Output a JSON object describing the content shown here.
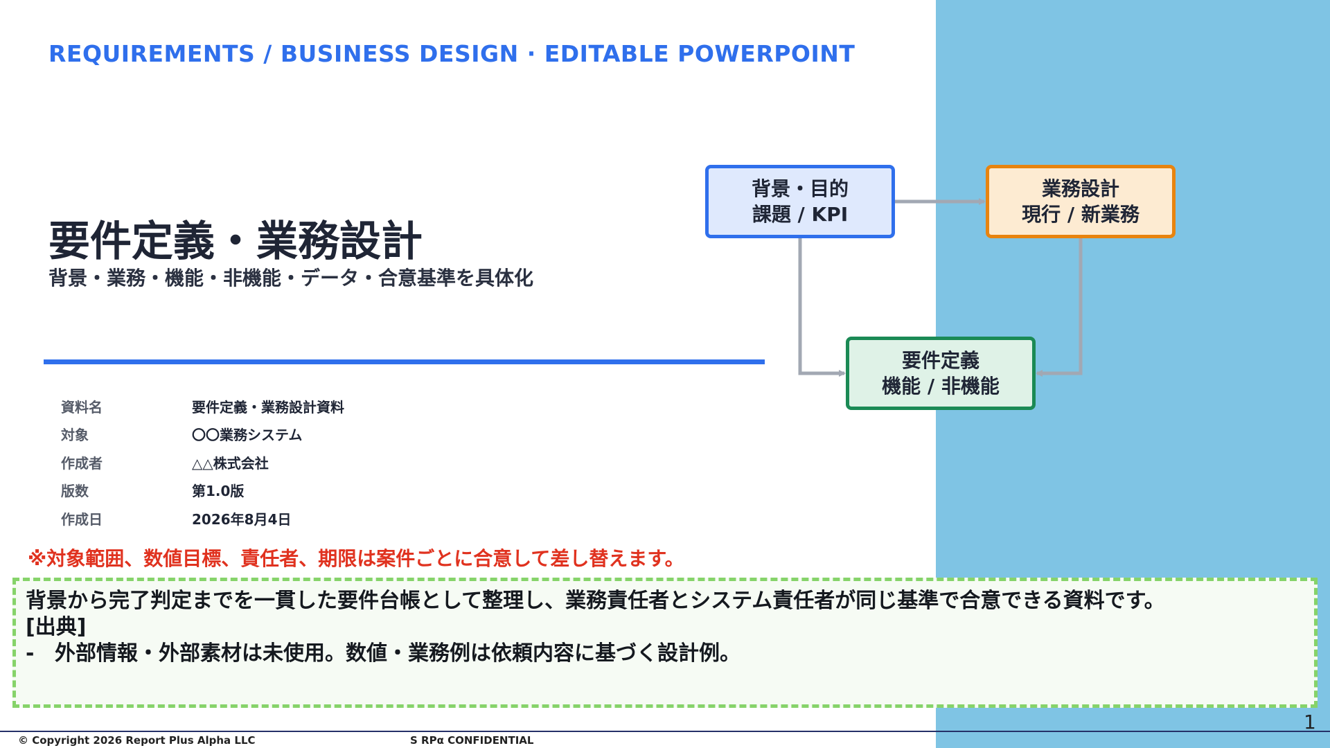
{
  "header": {
    "eyebrow": "REQUIREMENTS / BUSINESS DESIGN · EDITABLE POWERPOINT"
  },
  "cover": {
    "title": "要件定義・業務設計",
    "subtitle": "背景・業務・機能・非機能・データ・合意基準を具体化"
  },
  "meta": [
    {
      "label": "資料名",
      "value": "要件定義・業務設計資料"
    },
    {
      "label": "対象",
      "value": "〇〇業務システム"
    },
    {
      "label": "作成者",
      "value": "△△株式会社"
    },
    {
      "label": "版数",
      "value": "第1.0版"
    },
    {
      "label": "作成日",
      "value": "2026年8月4日"
    }
  ],
  "note": "※対象範囲、数値目標、責任者、期限は案件ごとに合意して差し替えます。",
  "summary": {
    "text": "背景から完了判定までを一貫した要件台帳として整理し、業務責任者とシステム責任者が同じ基準で合意できる資料です。",
    "source_heading": "[出典]",
    "source_dash": "-",
    "source_item": "外部情報・外部素材は未使用。数値・業務例は依頼内容に基づく設計例。"
  },
  "diagram": {
    "nodes": [
      {
        "line1": "背景・目的",
        "line2": "課題 / KPI"
      },
      {
        "line1": "業務設計",
        "line2": "現行 / 新業務"
      },
      {
        "line1": "要件定義",
        "line2": "機能 / 非機能"
      }
    ],
    "colors": {
      "blue_border": "#2f6fec",
      "orange_border": "#e8840f",
      "green_border": "#1b8a55",
      "connector": "#a2a8b3"
    }
  },
  "footer": {
    "copyright": "© Copyright 2026 Report Plus Alpha LLC",
    "confidential": "S RPα CONFIDENTIAL",
    "page_number": "1"
  },
  "colors": {
    "accent_blue": "#2f6fec",
    "side_panel": "#7fc4e4",
    "note_red": "#e0321f",
    "summary_border": "#86d36a"
  }
}
